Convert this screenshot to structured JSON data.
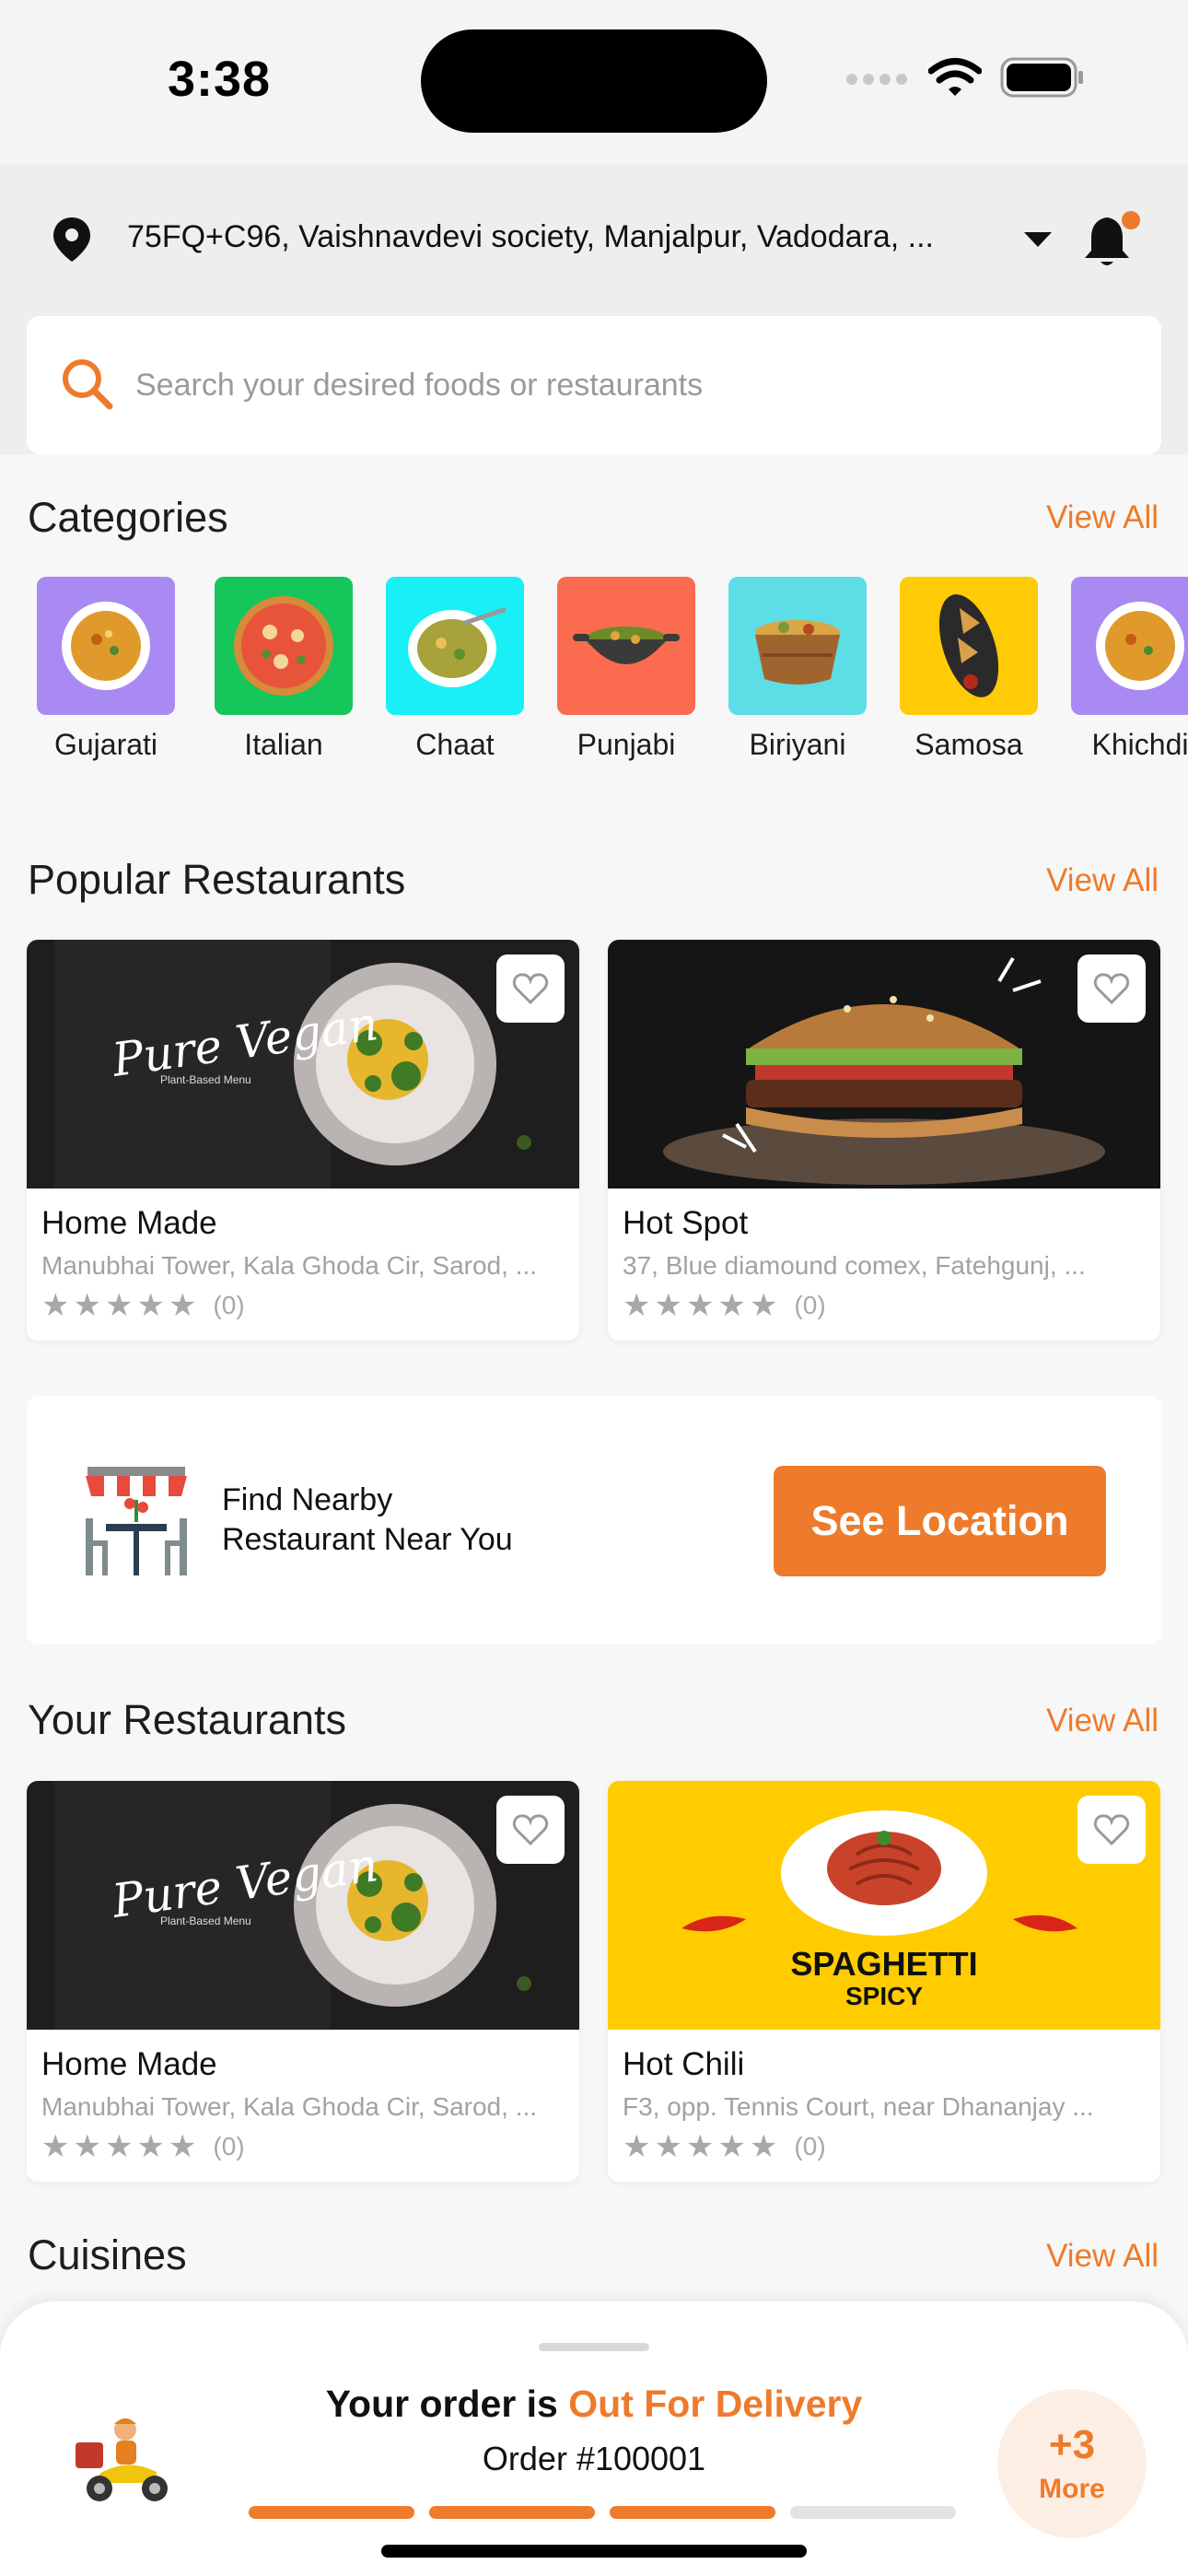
{
  "status_bar": {
    "time": "3:38"
  },
  "location": {
    "address": "75FQ+C96, Vaishnavdevi society, Manjalpur, Vadodara, ..."
  },
  "search": {
    "placeholder": "Search your desired foods or restaurants"
  },
  "colors": {
    "accent": "#ee7b2b",
    "text": "#1d1d1d",
    "muted": "#a2a2a2",
    "background": "#f7f7f7"
  },
  "categories": {
    "title": "Categories",
    "view_all": "View All",
    "items": [
      {
        "label": "Gujarati",
        "bg": "#a98af2",
        "icon": "curry-bowl-icon"
      },
      {
        "label": "Italian",
        "bg": "#16c65a",
        "icon": "pizza-icon"
      },
      {
        "label": "Chaat",
        "bg": "#19f0f5",
        "icon": "chaat-bowl-icon"
      },
      {
        "label": "Punjabi",
        "bg": "#fb6b4f",
        "icon": "kadai-icon"
      },
      {
        "label": "Biriyani",
        "bg": "#5ddde6",
        "icon": "biryani-pot-icon"
      },
      {
        "label": "Samosa",
        "bg": "#ffcb07",
        "icon": "samosa-plate-icon"
      },
      {
        "label": "Khichdi",
        "bg": "#a98af2",
        "icon": "curry-bowl-icon"
      }
    ]
  },
  "popular": {
    "title": "Popular Restaurants",
    "view_all": "View All",
    "items": [
      {
        "name": "Home Made",
        "address": "Manubhai Tower, Kala Ghoda Cir, Sarod, ...",
        "rating_count": "(0)",
        "image_title": "Pure Vegan",
        "image_subtitle": "Plant-Based Menu"
      },
      {
        "name": "Hot Spot",
        "address": "37, Blue diamound comex, Fatehgunj, ...",
        "rating_count": "(0)"
      }
    ]
  },
  "nearby": {
    "line1": "Find Nearby",
    "line2": "Restaurant Near You",
    "button": "See Location"
  },
  "yours": {
    "title": "Your Restaurants",
    "view_all": "View All",
    "items": [
      {
        "name": "Home Made",
        "address": "Manubhai Tower, Kala Ghoda Cir, Sarod, ...",
        "rating_count": "(0)",
        "image_title": "Pure Vegan",
        "image_subtitle": "Plant-Based Menu"
      },
      {
        "name": "Hot Chili",
        "address": "F3, opp. Tennis Court, near Dhananjay ...",
        "rating_count": "(0)",
        "image_title": "SPAGHETTI",
        "image_subtitle": "SPICY"
      }
    ]
  },
  "cuisines": {
    "title": "Cuisines",
    "view_all": "View All"
  },
  "order": {
    "status_prefix": "Your order is",
    "status": "Out For Delivery",
    "number": "Order #100001",
    "progress_done": 3,
    "progress_total": 4,
    "more_count": "+3",
    "more_label": "More"
  }
}
